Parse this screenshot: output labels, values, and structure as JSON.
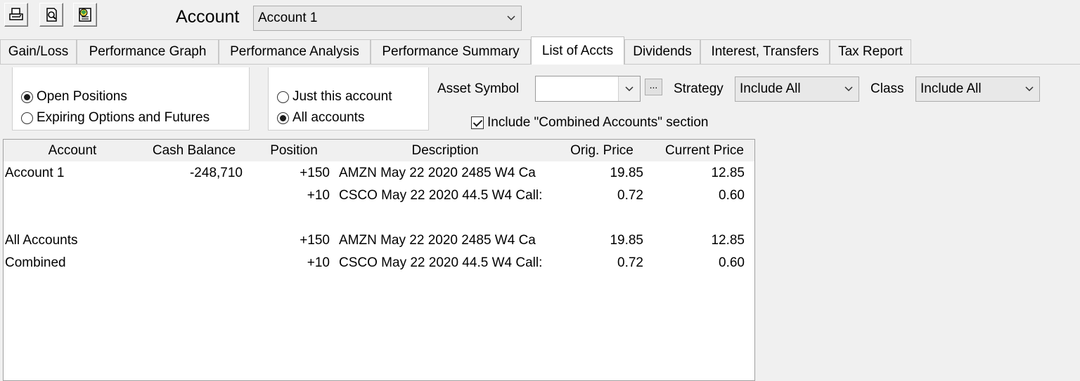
{
  "toolbar": {
    "buttons": [
      {
        "icon": "printer-icon"
      },
      {
        "icon": "print-preview-icon"
      },
      {
        "icon": "export-report-icon"
      }
    ],
    "account_label": "Account",
    "account_selected": "Account 1"
  },
  "tabs": [
    {
      "label": "Gain/Loss",
      "active": false
    },
    {
      "label": "Performance Graph",
      "active": false
    },
    {
      "label": "Performance Analysis",
      "active": false
    },
    {
      "label": "Performance Summary",
      "active": false
    },
    {
      "label": "List of Accts",
      "active": true
    },
    {
      "label": "Dividends",
      "active": false
    },
    {
      "label": "Interest, Transfers",
      "active": false
    },
    {
      "label": "Tax Report",
      "active": false
    }
  ],
  "options": {
    "positions": [
      {
        "label": "Open Positions",
        "selected": true
      },
      {
        "label": "Expiring Options and Futures",
        "selected": false
      }
    ],
    "scope": [
      {
        "label": "Just this account",
        "selected": false
      },
      {
        "label": "All accounts",
        "selected": true
      }
    ],
    "asset_symbol_label": "Asset Symbol",
    "asset_symbol_value": "",
    "ellipsis_label": "...",
    "strategy_label": "Strategy",
    "strategy_selected": "Include All",
    "class_label": "Class",
    "class_selected": "Include All",
    "include_combined_label": "Include \"Combined Accounts\" section",
    "include_combined_checked": true
  },
  "grid": {
    "columns": [
      "Account",
      "Cash Balance",
      "Position",
      "Description",
      "Orig. Price",
      "Current Price"
    ],
    "rows": [
      {
        "account": "Account 1",
        "cash": "-248,710",
        "position": "+150",
        "description": "AMZN May 22 2020 2485 W4 Ca",
        "orig": "19.85",
        "current": "12.85"
      },
      {
        "account": "",
        "cash": "",
        "position": "+10",
        "description": "CSCO May 22 2020 44.5 W4 Call:",
        "orig": "0.72",
        "current": "0.60"
      },
      {
        "account": "",
        "cash": "",
        "position": "",
        "description": "",
        "orig": "",
        "current": ""
      },
      {
        "account": "All Accounts",
        "cash": "",
        "position": "+150",
        "description": "AMZN May 22 2020 2485 W4 Ca",
        "orig": "19.85",
        "current": "12.85"
      },
      {
        "account": "Combined",
        "cash": "",
        "position": "+10",
        "description": "CSCO May 22 2020 44.5 W4 Call:",
        "orig": "0.72",
        "current": "0.60"
      }
    ]
  }
}
